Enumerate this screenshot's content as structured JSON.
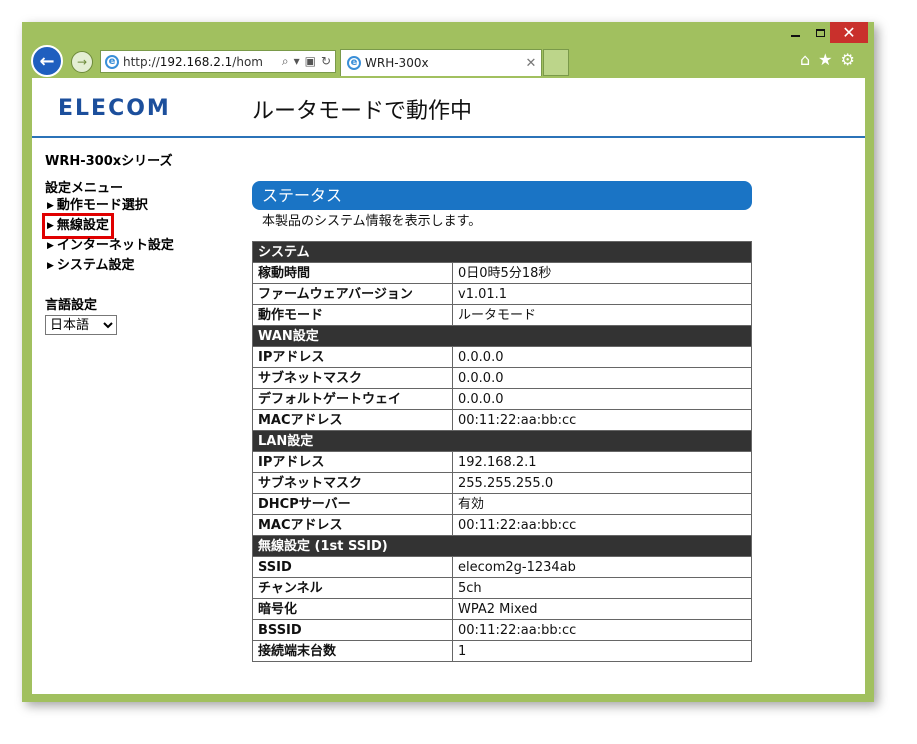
{
  "browser": {
    "url_prefix": "http://",
    "url_host": "192.168.2.1",
    "url_rest": "/hom",
    "tab_title": "WRH-300x"
  },
  "header": {
    "logo": "ELECOM",
    "title": "ルータモードで動作中"
  },
  "sidebar": {
    "model": "WRH-300xシリーズ",
    "menu_title": "設定メニュー",
    "items": [
      {
        "label": "動作モード選択"
      },
      {
        "label": "無線設定"
      },
      {
        "label": "インターネット設定"
      },
      {
        "label": "システム設定"
      }
    ],
    "lang_title": "言語設定",
    "lang_value": "日本語"
  },
  "main": {
    "status_title": "ステータス",
    "description": "本製品のシステム情報を表示します。",
    "sections": [
      {
        "title": "システム",
        "rows": [
          {
            "label": "稼動時間",
            "value": "0日0時5分18秒"
          },
          {
            "label": "ファームウェアバージョン",
            "value": "v1.01.1"
          },
          {
            "label": "動作モード",
            "value": "ルータモード"
          }
        ]
      },
      {
        "title": "WAN設定",
        "rows": [
          {
            "label": "IPアドレス",
            "value": "0.0.0.0"
          },
          {
            "label": "サブネットマスク",
            "value": "0.0.0.0"
          },
          {
            "label": "デフォルトゲートウェイ",
            "value": "0.0.0.0"
          },
          {
            "label": "MACアドレス",
            "value": "00:11:22:aa:bb:cc"
          }
        ]
      },
      {
        "title": "LAN設定",
        "rows": [
          {
            "label": "IPアドレス",
            "value": "192.168.2.1"
          },
          {
            "label": "サブネットマスク",
            "value": "255.255.255.0"
          },
          {
            "label": "DHCPサーバー",
            "value": "有効"
          },
          {
            "label": "MACアドレス",
            "value": "00:11:22:aa:bb:cc"
          }
        ]
      },
      {
        "title": "無線設定 (1st SSID)",
        "rows": [
          {
            "label": "SSID",
            "value": "elecom2g-1234ab"
          },
          {
            "label": "チャンネル",
            "value": "5ch"
          },
          {
            "label": "暗号化",
            "value": "WPA2 Mixed"
          },
          {
            "label": "BSSID",
            "value": "00:11:22:aa:bb:cc"
          },
          {
            "label": "接続端末台数",
            "value": "1"
          }
        ]
      }
    ]
  },
  "colors": {
    "frame": "#a1c05f",
    "accent": "#1a74c5",
    "section_bg": "#333333",
    "highlight": "#e00000"
  }
}
